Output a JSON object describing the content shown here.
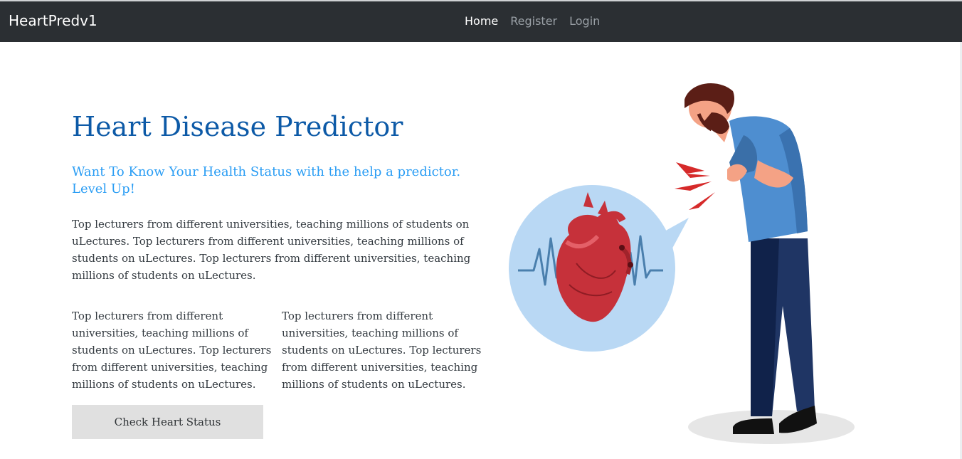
{
  "navbar": {
    "brand": "HeartPredv1",
    "links": [
      {
        "label": "Home",
        "active": true
      },
      {
        "label": "Register",
        "active": false
      },
      {
        "label": "Login",
        "active": false
      }
    ]
  },
  "hero": {
    "title": "Heart Disease Predictor",
    "subtitle": "Want To Know Your Health Status with the help a predictor. Level Up!",
    "paragraph": "Top lecturers from different universities, teaching millions of students on uLectures. Top lecturers from different universities, teaching millions of students on uLectures. Top lecturers from different universities, teaching millions of students on uLectures.",
    "columns": [
      "Top lecturers from different universities, teaching millions of students on uLectures. Top lecturers from different universities, teaching millions of students on uLectures.",
      "Top lecturers from different universities, teaching millions of students on uLectures. Top lecturers from different universities, teaching millions of students on uLectures."
    ],
    "button_label": "Check Heart Status"
  },
  "colors": {
    "navbar_bg": "#2b2f33",
    "title": "#0d5aa7",
    "subtitle": "#2a9df4",
    "button_bg": "#e0e0e0"
  },
  "illustration": {
    "icon": "man-with-heart-pain-illustration"
  }
}
